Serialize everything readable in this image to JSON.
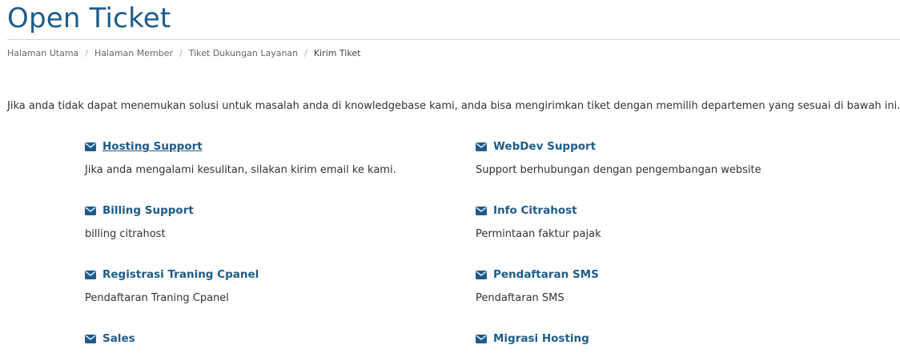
{
  "page": {
    "title": "Open Ticket",
    "intro": "Jika anda tidak dapat menemukan solusi untuk masalah anda di knowledgebase kami, anda bisa mengirimkan tiket dengan memilih departemen yang sesuai di bawah ini."
  },
  "breadcrumb": {
    "items": [
      {
        "label": "Halaman Utama"
      },
      {
        "label": "Halaman Member"
      },
      {
        "label": "Tiket Dukungan Layanan"
      },
      {
        "label": "Kirim Tiket"
      }
    ],
    "separator": "/"
  },
  "departments": [
    {
      "name": " Hosting Support",
      "description": "Jika anda mengalami kesulitan, silakan kirim email ke kami.",
      "icon": "envelope-icon"
    },
    {
      "name": "WebDev Support",
      "description": "Support berhubungan dengan pengembangan website",
      "icon": "envelope-icon"
    },
    {
      "name": "Billing Support",
      "description": "billing citrahost",
      "icon": "envelope-icon"
    },
    {
      "name": "Info Citrahost",
      "description": "Permintaan faktur pajak",
      "icon": "envelope-icon"
    },
    {
      "name": "Registrasi Traning Cpanel",
      "description": "Pendaftaran Traning Cpanel",
      "icon": "envelope-icon"
    },
    {
      "name": "Pendaftaran SMS",
      "description": "Pendaftaran SMS",
      "icon": "envelope-icon"
    },
    {
      "name": "Sales",
      "description": "",
      "icon": "envelope-icon"
    },
    {
      "name": "Migrasi Hosting",
      "description": "",
      "icon": "envelope-icon"
    }
  ],
  "colors": {
    "accent": "#1d5c8b",
    "text": "#333333",
    "muted": "#6b6b6b",
    "rule": "#d6d6d6"
  }
}
